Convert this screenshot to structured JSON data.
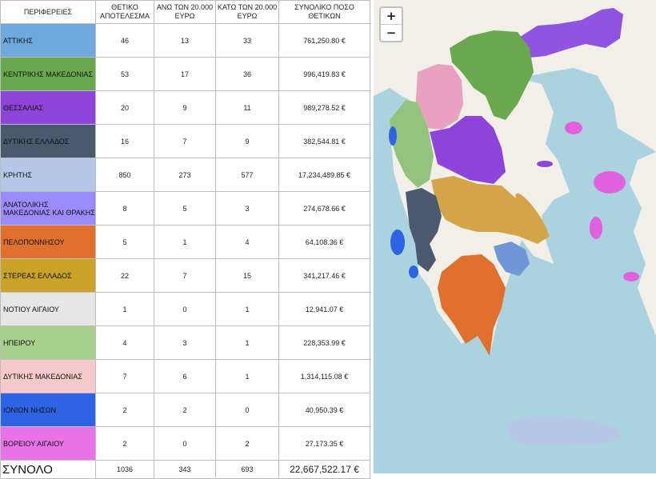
{
  "table": {
    "headers": [
      "ΠΕΡΙΦΕΡΕΙΕΣ",
      "ΘΕΤΙΚΟ ΑΠΟΤΕΛΕΣΜΑ",
      "ΑΝΩ ΤΩΝ 20.000 ΕΥΡΩ",
      "ΚΑΤΩ ΤΩΝ 20.000 ΕΥΡΩ",
      "ΣΥΝΟΛΙΚΟ ΠΟΣΟ ΘΕΤΙΚΩΝ"
    ],
    "rows": [
      {
        "region": "ΑΤΤΙΚΗΣ",
        "color": "#6fa8dc",
        "positive": "46",
        "above": "13",
        "below": "33",
        "amount": "761,250.80 €"
      },
      {
        "region": "ΚΕΝΤΡΙΚΗΣ  ΜΑΚΕΔΟΝΙΑΣ",
        "color": "#6aa84f",
        "positive": "53",
        "above": "17",
        "below": "36",
        "amount": "996,419.83 €"
      },
      {
        "region": "ΘΕΣΣΑΛΙΑΣ",
        "color": "#8e44d8",
        "positive": "20",
        "above": "9",
        "below": "11",
        "amount": "989,278.52 €"
      },
      {
        "region": "ΔΥΤΙΚΗΣ ΕΛΛΑΔΟΣ",
        "color": "#4a5a6e",
        "positive": "16",
        "above": "7",
        "below": "9",
        "amount": "382,544.81 €"
      },
      {
        "region": "ΚΡΗΤΗΣ",
        "color": "#b4c7e7",
        "positive": "850",
        "above": "273",
        "below": "577",
        "amount": "17,234,489.85 €"
      },
      {
        "region": "ΑΝΑΤΟΛΙΚΗΣ ΜΑΚΕΔΟΝΙΑΣ ΚΑΙ ΘΡΑΚΗΣ",
        "color": "#9b8bff",
        "positive": "8",
        "above": "5",
        "below": "3",
        "amount": "274,678.66 €"
      },
      {
        "region": "ΠΕΛΟΠΟΝΝΗΣΟΥ",
        "color": "#e0702e",
        "positive": "5",
        "above": "1",
        "below": "4",
        "amount": "64,108.36 €"
      },
      {
        "region": "ΣΤΕΡΕΑΣ ΕΛΛΑΔΟΣ",
        "color": "#c9a227",
        "positive": "22",
        "above": "7",
        "below": "15",
        "amount": "341,217.46 €"
      },
      {
        "region": "ΝΟΤΙΟΥ ΑΙΓΑΙΟΥ",
        "color": "#e6e6e6",
        "positive": "1",
        "above": "0",
        "below": "1",
        "amount": "12,941.07 €"
      },
      {
        "region": "ΗΠΕΙΡΟΥ",
        "color": "#a8d08d",
        "positive": "4",
        "above": "3",
        "below": "1",
        "amount": "228,353.99 €"
      },
      {
        "region": "ΔΥΤΙΚΗΣ ΜΑΚΕΔΟΝΙΑΣ",
        "color": "#f6c9cc",
        "positive": "7",
        "above": "6",
        "below": "1",
        "amount": "1,314,115.08 €"
      },
      {
        "region": "ΙΟΝΙΩΝ ΝΗΣΩΝ",
        "color": "#2e63e6",
        "positive": "2",
        "above": "2",
        "below": "0",
        "amount": "40,950.39 €"
      },
      {
        "region": "ΒΟΡΕΙΟΥ ΑΙΓΑΙΟΥ",
        "color": "#e873e8",
        "positive": "2",
        "above": "0",
        "below": "2",
        "amount": "27,173.35 €"
      }
    ],
    "total": {
      "label": "ΣΥΝΟΛΟ",
      "positive": "1036",
      "above": "343",
      "below": "693",
      "amount": "22,667,522.17 €"
    }
  },
  "map": {
    "zoom_in_label": "+",
    "zoom_out_label": "−",
    "colors": {
      "sea": "#aad3df",
      "land": "#f2efe9",
      "attica": "#6f97d8",
      "central_macedonia": "#6aa84f",
      "thessaly": "#8e44d8",
      "western_greece": "#4a5a6e",
      "crete": "#b4c7e7",
      "east_macedonia_thrace": "#8f55e0",
      "peloponnese": "#e0702e",
      "central_greece": "#d4a449",
      "epirus": "#93c47d",
      "western_macedonia": "#e8a2c0",
      "ionian_islands": "#2e63e6",
      "north_aegean": "#e060e0"
    }
  }
}
